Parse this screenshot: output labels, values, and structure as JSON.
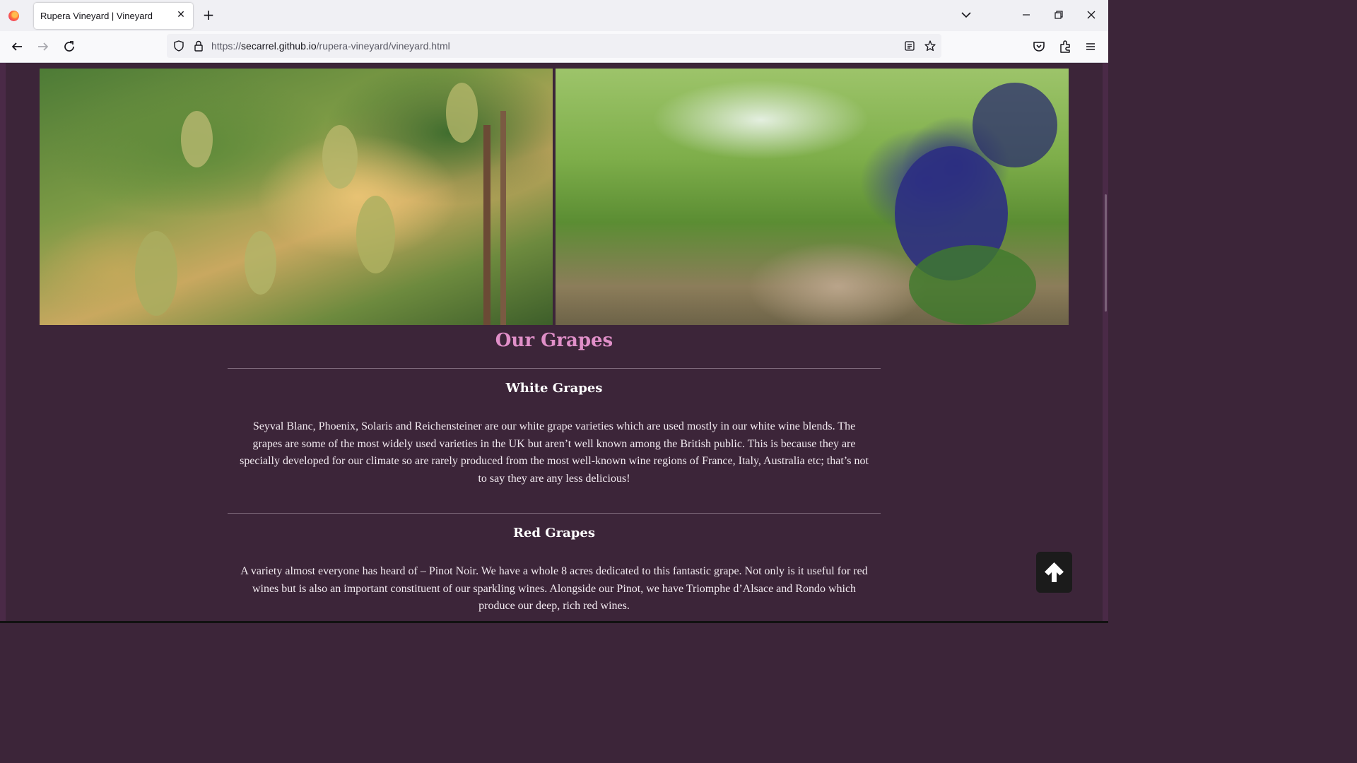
{
  "browser": {
    "tab_title": "Rupera Vineyard | Vineyard",
    "url_scheme": "https://",
    "url_host": "secarrel.github.io",
    "url_path": "/rupera-vineyard/vineyard.html"
  },
  "page": {
    "section_title": "Our Grapes",
    "white": {
      "heading": "White Grapes",
      "text": "Seyval Blanc, Phoenix, Solaris and Reichensteiner are our white grape varieties which are used mostly in our white wine blends. The grapes are some of the most widely used varieties in the UK but aren’t well known among the British public. This is because they are specially developed for our climate so are rarely produced from the most well-known wine regions of France, Italy, Australia etc; that’s not to say they are any less delicious!"
    },
    "red": {
      "heading": "Red Grapes",
      "text": "A variety almost everyone has heard of – Pinot Noir. We have a whole 8 acres dedicated to this fantastic grape. Not only is it useful for red wines but is also an important constituent of our sparkling wines. Alongside our Pinot, we have Triomphe d’Alsace and Rondo which produce our deep, rich red wines."
    }
  },
  "colors": {
    "page_background": "#3c2539",
    "section_title": "#e08fc8",
    "body_text": "#f2eaf0",
    "back_to_top_bg": "#1b1b1b"
  },
  "icons": {
    "browser": "firefox-logo-icon",
    "back_to_top": "arrow-up-icon"
  }
}
